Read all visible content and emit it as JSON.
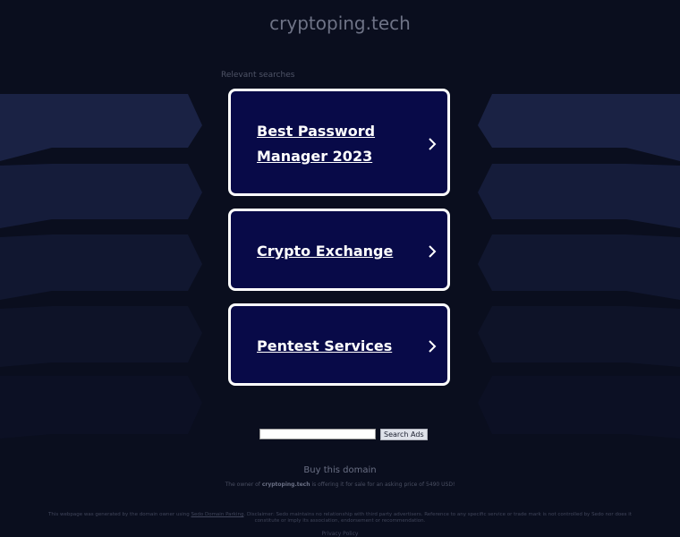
{
  "site": {
    "title": "cryptoping.tech"
  },
  "relevant_label": "Relevant searches",
  "cards": [
    {
      "label": "Best Password Manager 2023"
    },
    {
      "label": "Crypto Exchange"
    },
    {
      "label": "Pentest Services"
    }
  ],
  "search": {
    "value": "",
    "button_label": "Search Ads"
  },
  "buy": {
    "label": "Buy this domain"
  },
  "owner": {
    "prefix": "The owner of",
    "domain": "cryptoping.tech",
    "suffix": "is offering it for sale for an asking price of 5490 USD!"
  },
  "disclaimer": {
    "prefix": "This webpage was generated by the domain owner using",
    "link": "Sedo Domain Parking",
    "suffix": ". Disclaimer: Sedo maintains no relationship with third party advertisers. Reference to any specific service or trade mark is not controlled by Sedo nor does it constitute or imply its association, endorsement or recommendation."
  },
  "privacy": {
    "label": "Privacy Policy"
  },
  "colors": {
    "card_bg": "#080a48",
    "card_border": "#ffffff",
    "page_bg": "#0a0e1e"
  },
  "icons": {
    "card_arrow": "chevron-right-icon"
  }
}
